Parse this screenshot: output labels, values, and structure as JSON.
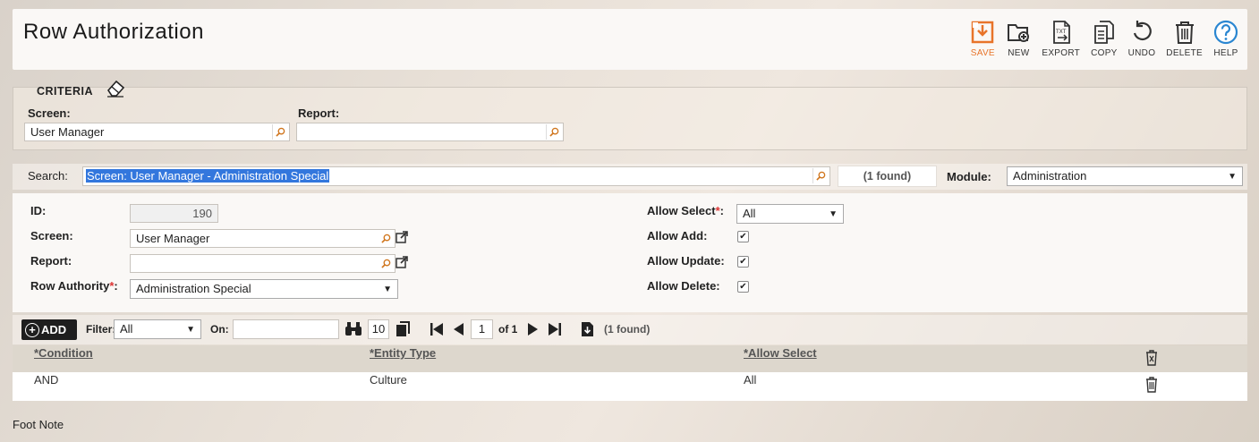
{
  "header": {
    "title": "Row Authorization",
    "toolbar": [
      {
        "label": "SAVE",
        "icon": "save-icon"
      },
      {
        "label": "NEW",
        "icon": "new-folder-icon"
      },
      {
        "label": "EXPORT",
        "icon": "export-txt-icon"
      },
      {
        "label": "COPY",
        "icon": "copy-icon"
      },
      {
        "label": "UNDO",
        "icon": "undo-icon"
      },
      {
        "label": "DELETE",
        "icon": "trash-icon"
      },
      {
        "label": "HELP",
        "icon": "help-icon"
      }
    ]
  },
  "criteria": {
    "title": "CRITERIA",
    "screen_label": "Screen:",
    "screen_value": "User Manager",
    "report_label": "Report:",
    "report_value": ""
  },
  "search": {
    "label": "Search:",
    "value": "Screen: User Manager - Administration Special",
    "found": "(1 found)",
    "module_label": "Module:",
    "module_value": "Administration"
  },
  "detail": {
    "id_label": "ID:",
    "id_value": "190",
    "screen_label": "Screen:",
    "screen_value": "User Manager",
    "report_label": "Report:",
    "report_value": "",
    "row_authority_label": "Row Authority",
    "row_authority_value": "Administration Special",
    "allow_select_label": "Allow Select",
    "allow_select_value": "All",
    "allow_add_label": "Allow Add:",
    "allow_update_label": "Allow Update:",
    "allow_delete_label": "Allow Delete:",
    "required_mark": "*",
    "colon": ":"
  },
  "grid_toolbar": {
    "add_label": "ADD",
    "filter_label": "Filter:",
    "filter_value": "All",
    "on_label": "On:",
    "on_value": "",
    "page_size": "10",
    "page_current": "1",
    "page_of": "of 1",
    "found": "(1 found)"
  },
  "grid": {
    "columns": [
      "*Condition",
      "*Entity Type",
      "*Allow Select"
    ],
    "rows": [
      {
        "condition": "AND",
        "entity_type": "Culture",
        "allow_select": "All"
      }
    ]
  },
  "footer": {
    "note": "Foot Note"
  },
  "colors": {
    "accent": "#e8742a",
    "help": "#2a86d1"
  }
}
